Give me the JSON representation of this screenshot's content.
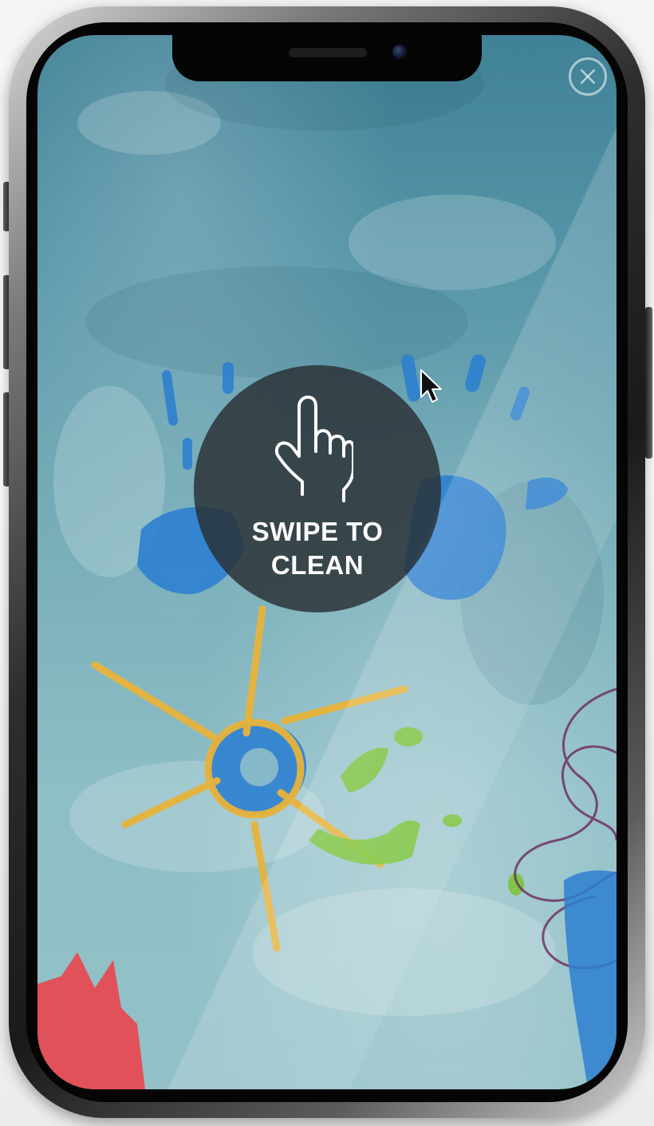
{
  "overlay": {
    "instruction": "SWIPE TO\nCLEAN",
    "hand_icon": "hand-pointer-icon"
  },
  "controls": {
    "close_icon": "close-icon"
  },
  "colors": {
    "overlay_bg": "#282e32",
    "wall_top": "#3f8196",
    "wall_bottom": "#93c1c7",
    "paint_blue": "#2d7fd0",
    "paint_yellow": "#e8b33b",
    "paint_green": "#7cc43a",
    "paint_red": "#e8484f",
    "scribble_purple": "#6b2a5a"
  }
}
